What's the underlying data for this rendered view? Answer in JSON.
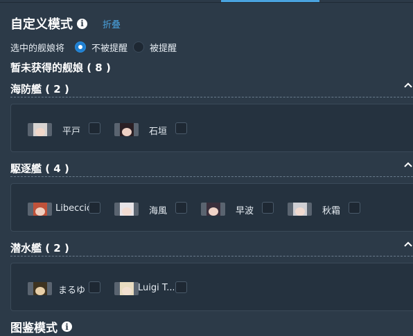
{
  "header": {
    "title": "自定义模式",
    "collapse_label": "折叠"
  },
  "selection": {
    "label": "选中的舰娘将",
    "options": [
      {
        "label": "不被提醒",
        "checked": true
      },
      {
        "label": "被提醒",
        "checked": false
      }
    ]
  },
  "missing": {
    "title": "暂未获得的舰娘 ( 8 )"
  },
  "groups": [
    {
      "title": "海防艦 ( 2 )",
      "ships": [
        {
          "name": "平戸",
          "hair": "#d8d4d2",
          "skin": "#f1d7c9"
        },
        {
          "name": "石垣",
          "hair": "#2a1f24",
          "skin": "#edd0c4"
        }
      ]
    },
    {
      "title": "駆逐艦 ( 4 )",
      "ships": [
        {
          "name": "Libeccio",
          "hair": "#c0523a",
          "skin": "#f0cfbf"
        },
        {
          "name": "海風",
          "hair": "#e7e4e8",
          "skin": "#f2dcd2"
        },
        {
          "name": "早波",
          "hair": "#3a2f3c",
          "skin": "#efd3c7"
        },
        {
          "name": "秋霜",
          "hair": "#cfcfd4",
          "skin": "#f0dad0"
        }
      ]
    },
    {
      "title": "潜水艦 ( 2 )",
      "ships": [
        {
          "name": "まるゆ",
          "hair": "#3e3320",
          "skin": "#e8cfa8"
        },
        {
          "name": "Luigi T...",
          "hair": "#e8dcc0",
          "skin": "#f2e0d0"
        }
      ]
    }
  ],
  "footer": {
    "title": "图鉴模式"
  },
  "colors": {
    "accent": "#4aa3df",
    "background": "#2c3a48",
    "panel": "#25323f"
  }
}
